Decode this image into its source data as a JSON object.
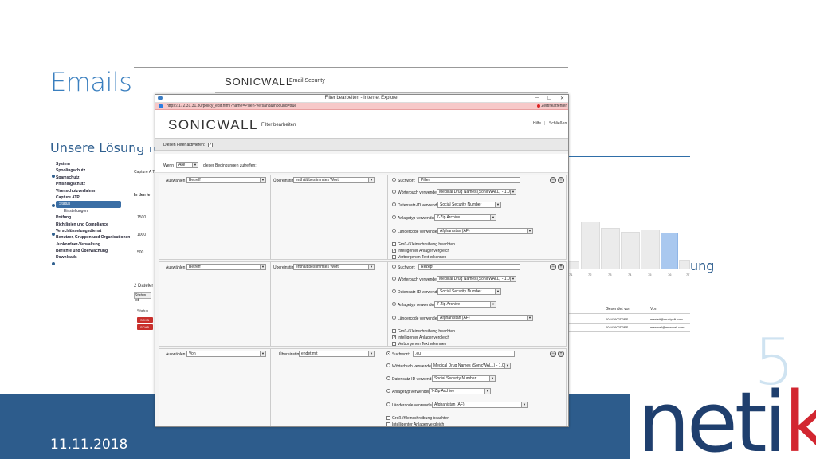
{
  "slide": {
    "title": "Emailsicherheit",
    "subtitle_start": "Unsere Lösung fü",
    "subtitle_end": "ung",
    "page_number": "5",
    "date": "11.11.2018",
    "logo": {
      "part1": "neti",
      "part2": "k"
    },
    "colors": {
      "title": "#3a7fbf",
      "footer": "#2d5c8c",
      "logo_blue": "#1f3f6e",
      "logo_red": "#d22630"
    }
  },
  "background_screen": {
    "brand": "SONICWALL",
    "product": "Email Security",
    "nav_items": [
      {
        "label": "System",
        "type": "item"
      },
      {
        "label": "Spoolingschutz",
        "type": "item"
      },
      {
        "label": "Spamschutz",
        "type": "item"
      },
      {
        "label": "Phishingschutz",
        "type": "item"
      },
      {
        "label": "Virenschutzverfahren",
        "type": "item"
      },
      {
        "label": "Capture ATP",
        "type": "item"
      },
      {
        "label": "Status",
        "type": "active"
      },
      {
        "label": "Einstellungen",
        "type": "sub"
      },
      {
        "label": "Prüfung",
        "type": "item"
      },
      {
        "label": "Richtlinien und Compliance",
        "type": "item"
      },
      {
        "label": "Verschlüsselungsdienst",
        "type": "item"
      },
      {
        "label": "Benutzer, Gruppen und Organisationen",
        "type": "item"
      },
      {
        "label": "Junkordner-Verwaltung",
        "type": "item"
      },
      {
        "label": "Berichte und Überwachung",
        "type": "item"
      },
      {
        "label": "Downloads",
        "type": "item"
      }
    ],
    "labels": {
      "capture": "Capture A T",
      "in_den": "In den le",
      "y1": "1500",
      "y2": "1000",
      "y3": "500",
      "dateien": "2 Dateier",
      "status_button": "Status ist",
      "status_header": "Status",
      "tag": "SCHÄ"
    },
    "chart_ticks": [
      "71",
      "72",
      "73",
      "74",
      "75",
      "76",
      "77"
    ],
    "table": {
      "headers": [
        "Gesendet von",
        "Von"
      ],
      "rows": [
        [
          "00441602D0PS",
          "maxfeit@mustpsft.com"
        ],
        [
          "00441602D0PS",
          "maxmail@muxmail.com"
        ]
      ]
    }
  },
  "ie_window": {
    "title": "Filter bearbeiten - Internet Explorer",
    "url": "https://172.31.31.30/policy_edit.html?name=Pillen-Versand&inbound=true",
    "cert": "Zertifikatfehler",
    "controls": {
      "minimize": "—",
      "maximize": "☐",
      "close": "✕"
    },
    "header": {
      "logo": "SONICWALL",
      "subtitle": "Filter bearbeiten",
      "help": "Hilfe",
      "close": "Schließen"
    },
    "enable_label": "Diesen Filter aktivieren:",
    "condition": {
      "wenn": "Wenn",
      "alle": "Alle",
      "text": "dieser Bedingungen zutreffen:"
    },
    "options": {
      "auswaehlen": "Auswählen:",
      "uebereinstimmung": "Übereinstimmung:",
      "suchwort": "Suchwort:",
      "woerterbuch": "Wörterbuch verwenden:",
      "datensatz": "Datensatz-ID verwenden:",
      "anlagetyp": "Anlagetyp verwenden:",
      "laendercode": "Ländercode verwenden:",
      "case": "Groß-/Kleinschreibung beachten",
      "intel": "Intelligenter Anlagenvergleich",
      "hidden": "Verborgenen Text erkennen"
    },
    "values": {
      "dictionary": "Medical Drug Names (SonicWALL) - 1.0",
      "record": "Social Security Number",
      "attachment": "7-Zip Archive",
      "country": "Afghanistan (AF)"
    },
    "blocks": [
      {
        "field": "Betreff",
        "match": "enthält bestimmtes Wort",
        "keyword": "Pillen"
      },
      {
        "field": "Betreff",
        "match": "enthält bestimmtes Wort",
        "keyword": "Rezept"
      },
      {
        "field": "Von",
        "match": "endet mit",
        "keyword": ".eu"
      }
    ],
    "plus_minus": {
      "minus": "−",
      "plus": "+"
    }
  }
}
